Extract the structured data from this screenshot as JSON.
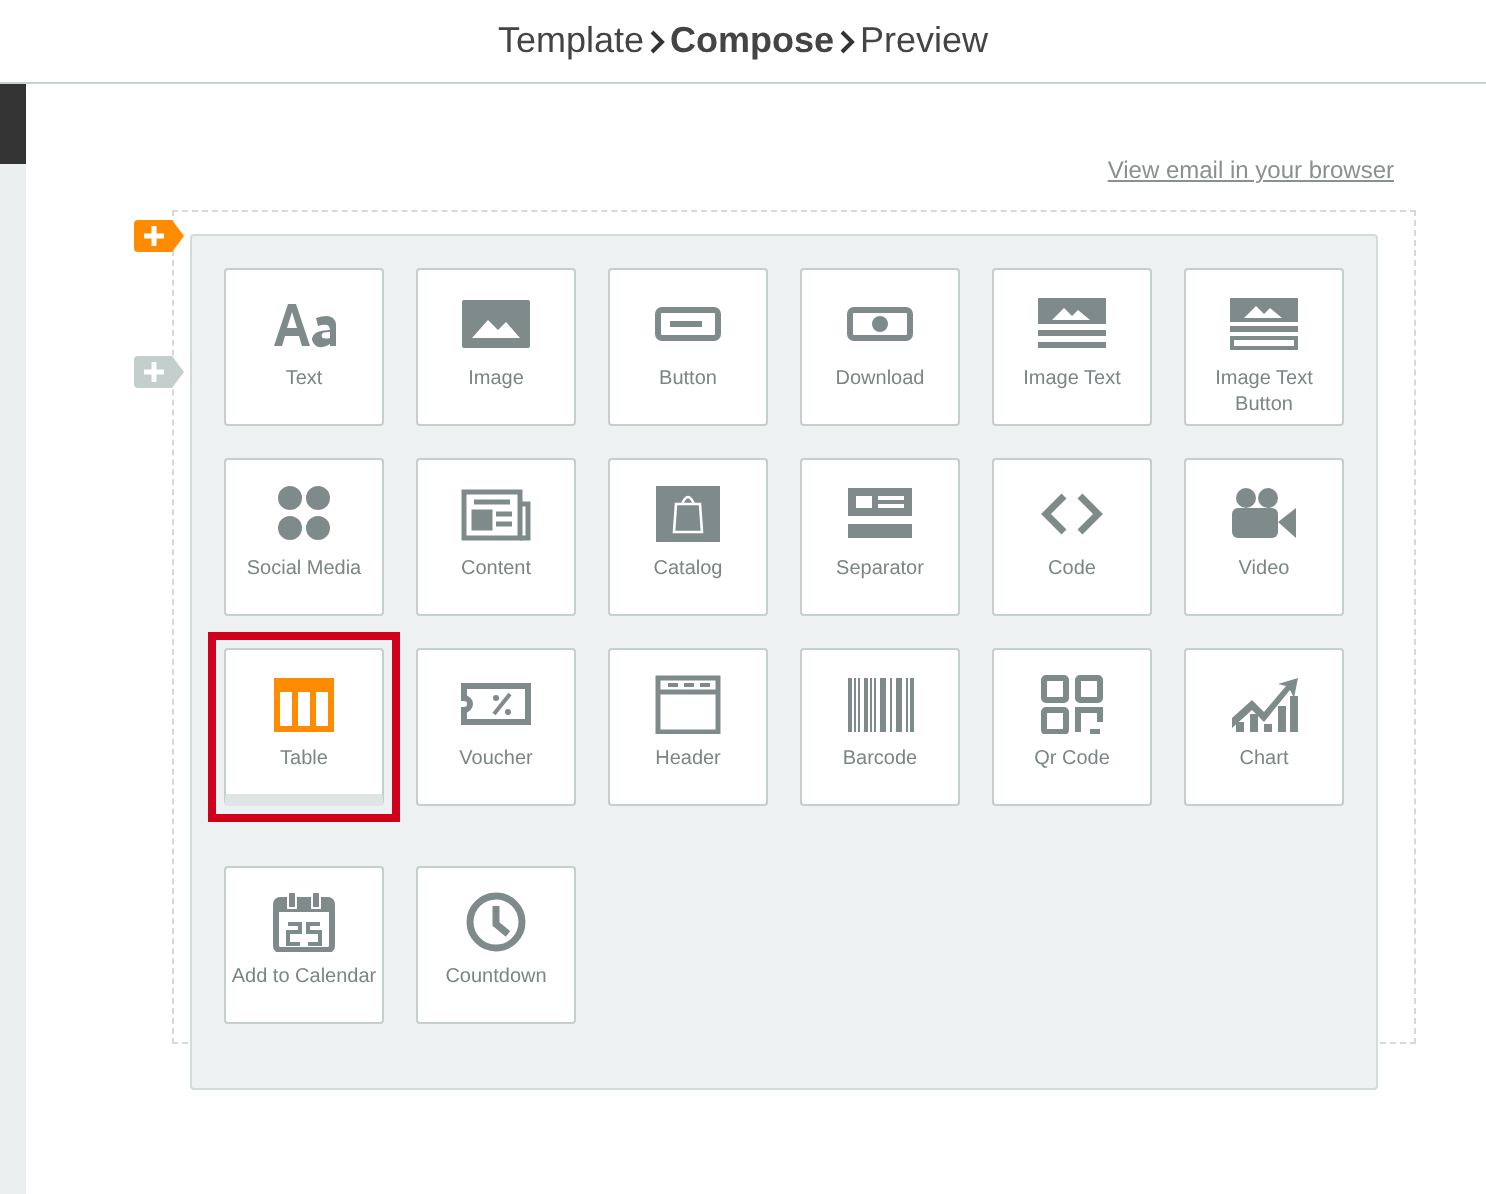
{
  "breadcrumb": [
    {
      "label": "Template",
      "selected": false
    },
    {
      "label": "Compose",
      "selected": true
    },
    {
      "label": "Preview",
      "selected": false
    }
  ],
  "view_in_browser_link": "View email in your browser",
  "blocks": [
    {
      "label": "Text",
      "selected": false
    },
    {
      "label": "Image",
      "selected": false
    },
    {
      "label": "Button",
      "selected": false
    },
    {
      "label": "Download",
      "selected": false
    },
    {
      "label": "Image Text",
      "selected": false
    },
    {
      "label": "Image Text Button",
      "selected": false
    },
    {
      "label": "Social Media",
      "selected": false
    },
    {
      "label": "Content",
      "selected": false
    },
    {
      "label": "Catalog",
      "selected": false
    },
    {
      "label": "Separator",
      "selected": false
    },
    {
      "label": "Code",
      "selected": false
    },
    {
      "label": "Video",
      "selected": false
    },
    {
      "label": "Table",
      "selected": true
    },
    {
      "label": "Voucher",
      "selected": false
    },
    {
      "label": "Header",
      "selected": false
    },
    {
      "label": "Barcode",
      "selected": false
    },
    {
      "label": "Qr Code",
      "selected": false
    },
    {
      "label": "Chart",
      "selected": false
    },
    {
      "label": "Add to Calendar",
      "selected": false
    },
    {
      "label": "Countdown",
      "selected": false
    }
  ]
}
